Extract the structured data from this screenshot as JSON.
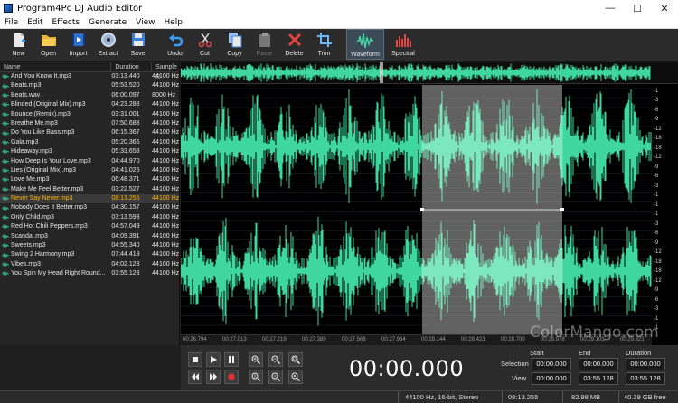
{
  "window": {
    "title": "Program4Pc DJ Audio Editor",
    "min": "—",
    "max": "☐",
    "close": "✕"
  },
  "menu": [
    "File",
    "Edit",
    "Effects",
    "Generate",
    "View",
    "Help"
  ],
  "toolbar": {
    "new": "New",
    "open": "Open",
    "import": "Import",
    "extract": "Extract",
    "save": "Save",
    "undo": "Undo",
    "cut": "Cut",
    "copy": "Copy",
    "paste": "Paste",
    "delete": "Delete",
    "trim": "Trim",
    "waveform": "Waveform",
    "spectral": "Spectral"
  },
  "filelist": {
    "columns": {
      "name": "Name",
      "duration": "Duration",
      "sample": "Sample R"
    },
    "files": [
      {
        "name": "And You Know It.mp3",
        "duration": "03:13.440",
        "rate": "44100 Hz"
      },
      {
        "name": "Beats.mp3",
        "duration": "05:53.520",
        "rate": "44100 Hz"
      },
      {
        "name": "Beats.wav",
        "duration": "06:00.097",
        "rate": "8000 Hz"
      },
      {
        "name": "Blinded (Original Mix).mp3",
        "duration": "04:23.288",
        "rate": "44100 Hz"
      },
      {
        "name": "Bounce (Remix).mp3",
        "duration": "03:31.001",
        "rate": "44100 Hz"
      },
      {
        "name": "Breathe Me.mp3",
        "duration": "07:50.688",
        "rate": "44100 Hz"
      },
      {
        "name": "Do You Like Bass.mp3",
        "duration": "06:15.367",
        "rate": "44100 Hz"
      },
      {
        "name": "Gala.mp3",
        "duration": "05:20.365",
        "rate": "44100 Hz"
      },
      {
        "name": "Hideaway.mp3",
        "duration": "05:33.658",
        "rate": "44100 Hz"
      },
      {
        "name": "How Deep Is Your Love.mp3",
        "duration": "04:44.970",
        "rate": "44100 Hz"
      },
      {
        "name": "Lies (Original Mix).mp3",
        "duration": "04:41.025",
        "rate": "44100 Hz"
      },
      {
        "name": "Love Me.mp3",
        "duration": "06:48.371",
        "rate": "44100 Hz"
      },
      {
        "name": "Make Me Feel Better.mp3",
        "duration": "03:22.527",
        "rate": "44100 Hz"
      },
      {
        "name": "Never Say Never.mp3",
        "duration": "08:13.255",
        "rate": "44100 Hz",
        "selected": true
      },
      {
        "name": "Nobody Does It Better.mp3",
        "duration": "04:30.157",
        "rate": "44100 Hz"
      },
      {
        "name": "Only Child.mp3",
        "duration": "03:13.593",
        "rate": "44100 Hz"
      },
      {
        "name": "Red Hot Chili Peppers.mp3",
        "duration": "04:57.049",
        "rate": "44100 Hz"
      },
      {
        "name": "Scandal.mp3",
        "duration": "04:09.391",
        "rate": "44100 Hz"
      },
      {
        "name": "Sweets.mp3",
        "duration": "04:55.340",
        "rate": "44100 Hz"
      },
      {
        "name": "Swing 2 Harmony.mp3",
        "duration": "07:44.419",
        "rate": "44100 Hz"
      },
      {
        "name": "Vibes.mp3",
        "duration": "04:02.128",
        "rate": "44100 Hz"
      },
      {
        "name": "You Spin My Head Right Round...",
        "duration": "03:55.128",
        "rate": "44100 Hz"
      }
    ]
  },
  "scale": [
    "-1",
    "-3",
    "-6",
    "-9",
    "-12",
    "-18",
    "-18",
    "-12",
    "-9",
    "-6",
    "-3",
    "-1",
    "-1",
    "-1",
    "-3",
    "-6",
    "-9",
    "-12",
    "-18",
    "-18",
    "-12",
    "-9",
    "-6",
    "-3",
    "-1",
    "-1"
  ],
  "timeline": [
    "00:26.794",
    "00:27.013",
    "00:27.219",
    "00:27.389",
    "00:27.568",
    "00:27.964",
    "00:28.144",
    "00:28.423",
    "00:28.700",
    "00:28.978",
    "00:29.103",
    "00:29.321"
  ],
  "transport": {
    "time": "00:00.000"
  },
  "range": {
    "headers": {
      "start": "Start",
      "end": "End",
      "duration": "Duration"
    },
    "selection": {
      "label": "Selection",
      "start": "00:00.000",
      "end": "00:00.000",
      "duration": "00:00.000"
    },
    "view": {
      "label": "View",
      "start": "00:00.000",
      "end": "03:55.128",
      "duration": "03:55.128"
    }
  },
  "status": {
    "format": "44100 Hz, 16-bit, Stereo",
    "length": "08:13.255",
    "size": "82.98 MB",
    "free": "40.39 GB free"
  },
  "watermark": "ColorMango.com",
  "colors": {
    "wave": "#3fd6a0",
    "wave_selected": "#7de8bf",
    "selection": "#b0b0b0",
    "accent_selected_row": "#ffb400"
  }
}
